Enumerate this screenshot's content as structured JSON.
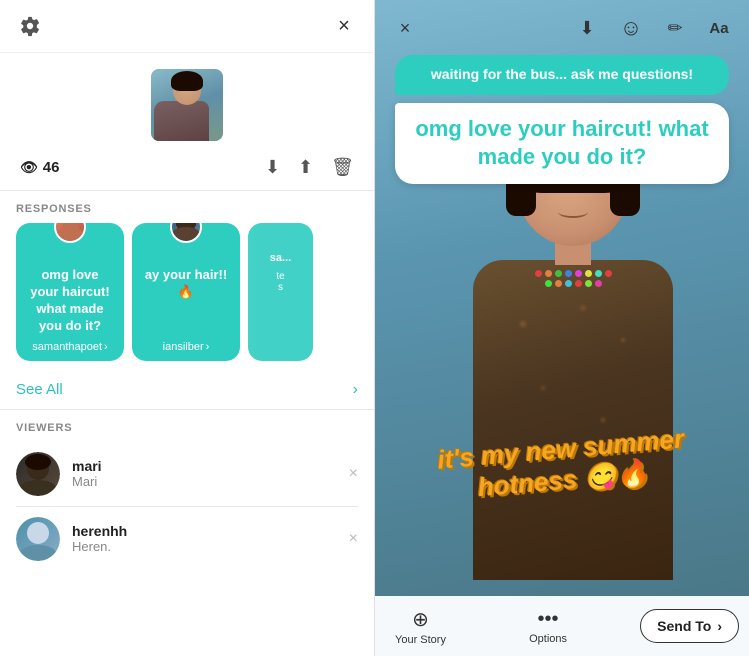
{
  "left": {
    "gear_label": "⚙",
    "close_label": "×",
    "view_count": "46",
    "sections": {
      "responses": "RESPONSES",
      "viewers": "VIEWERS"
    },
    "response_cards": [
      {
        "text": "omg love your haircut! what made you do it?",
        "username": "samanthapoet",
        "avatar_color_1": "#e08060",
        "avatar_color_2": "#c05040"
      },
      {
        "text": "ay your hair!! 🔥",
        "username": "iansilber",
        "avatar_color_1": "#3a5a80",
        "avatar_color_2": "#5a7aa0"
      },
      {
        "text": "sa...",
        "username": "s",
        "avatar_color_1": "#80c080",
        "avatar_color_2": "#408040"
      }
    ],
    "see_all": "See All",
    "viewers": [
      {
        "name": "mari",
        "handle": "Mari"
      },
      {
        "name": "herenhh",
        "handle": "Heren."
      }
    ]
  },
  "right": {
    "qa_prompt": "waiting for the bus... ask me questions!",
    "qa_response": "omg love your haircut! what made you do it?",
    "summer_sticker": "it's my new summer hotness 😋🔥",
    "footer": {
      "your_story_label": "Your Story",
      "options_label": "Options",
      "send_to_label": "Send To"
    },
    "icons": {
      "back": "×",
      "download": "⬇",
      "face": "☺",
      "pen": "✏",
      "text": "Aa"
    }
  },
  "beads": [
    "#e04040",
    "#e08040",
    "#40c040",
    "#4080e0",
    "#e040e0",
    "#e0e040",
    "#40e0c0",
    "#e04040",
    "#40e040",
    "#e08040",
    "#40c0e0",
    "#e04040",
    "#80e040",
    "#e040a0"
  ]
}
